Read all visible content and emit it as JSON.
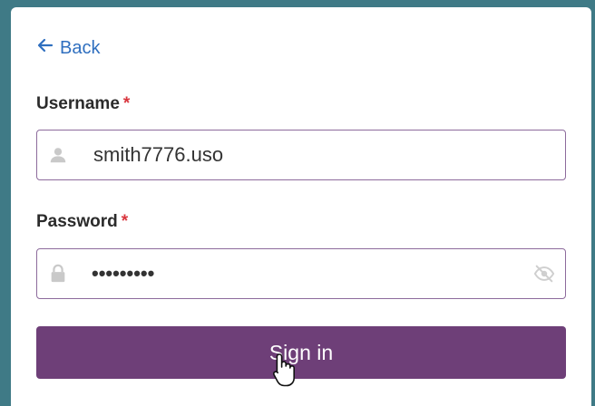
{
  "back": {
    "label": "Back"
  },
  "username": {
    "label": "Username",
    "required_mark": "*",
    "value": "smith7776.uso"
  },
  "password": {
    "label": "Password",
    "required_mark": "*",
    "masked_value": "•••••••••"
  },
  "signin": {
    "label": "Sign in"
  },
  "colors": {
    "background": "#3f7a86",
    "primary": "#6e3f78",
    "link": "#2f6fbf",
    "required": "#d9363e",
    "field_border": "#8d6b9c"
  },
  "icons": {
    "back": "arrow-left-icon",
    "username": "user-icon",
    "password": "lock-icon",
    "toggle": "eye-slash-icon",
    "cursor": "hand-pointer-icon"
  }
}
